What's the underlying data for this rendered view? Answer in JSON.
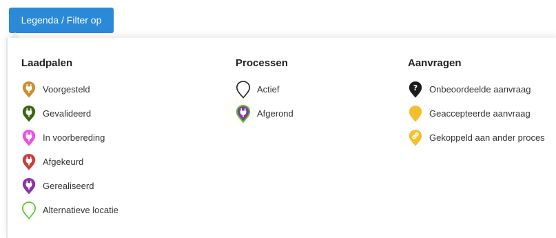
{
  "toolbar": {
    "legend_button_label": "Legenda / Filter op",
    "accent": "#2b8ad8"
  },
  "columns": [
    {
      "heading": "Laadpalen",
      "items": [
        {
          "label": "Voorgesteld",
          "icon": "plug-pin-icon",
          "color": "#cc8f2e",
          "variant": "filled-plug"
        },
        {
          "label": "Gevalideerd",
          "icon": "plug-pin-icon",
          "color": "#3d6512",
          "variant": "filled-plug"
        },
        {
          "label": "In voorbereding",
          "icon": "plug-pin-icon",
          "color": "#ef4ee3",
          "variant": "filled-plug"
        },
        {
          "label": "Afgekeurd",
          "icon": "plug-pin-icon",
          "color": "#c63f3c",
          "variant": "filled-plug"
        },
        {
          "label": "Gerealiseerd",
          "icon": "plug-pin-icon",
          "color": "#8a35a6",
          "variant": "filled-plug"
        },
        {
          "label": "Alternatieve locatie",
          "icon": "outline-pin-icon",
          "color": "#4fc81e",
          "variant": "outline"
        }
      ]
    },
    {
      "heading": "Processen",
      "items": [
        {
          "label": "Actief",
          "icon": "outline-pin-icon",
          "color": "#222222",
          "variant": "outline"
        },
        {
          "label": "Afgerond",
          "icon": "plug-pin-icon",
          "color": "#8a35a6",
          "stroke": "#4fc81e",
          "variant": "filled-plug-outlined"
        }
      ]
    },
    {
      "heading": "Aanvragen",
      "items": [
        {
          "label": "Onbeoordeelde aanvraag",
          "icon": "question-pin-icon",
          "color": "#1c1c1c",
          "variant": "question"
        },
        {
          "label": "Geaccepteerde aanvraag",
          "icon": "pin-icon",
          "color": "#f5be2c",
          "variant": "plain"
        },
        {
          "label": "Gekoppeld aan ander proces",
          "icon": "link-pin-icon",
          "color": "#f5be2c",
          "variant": "link"
        }
      ]
    }
  ]
}
